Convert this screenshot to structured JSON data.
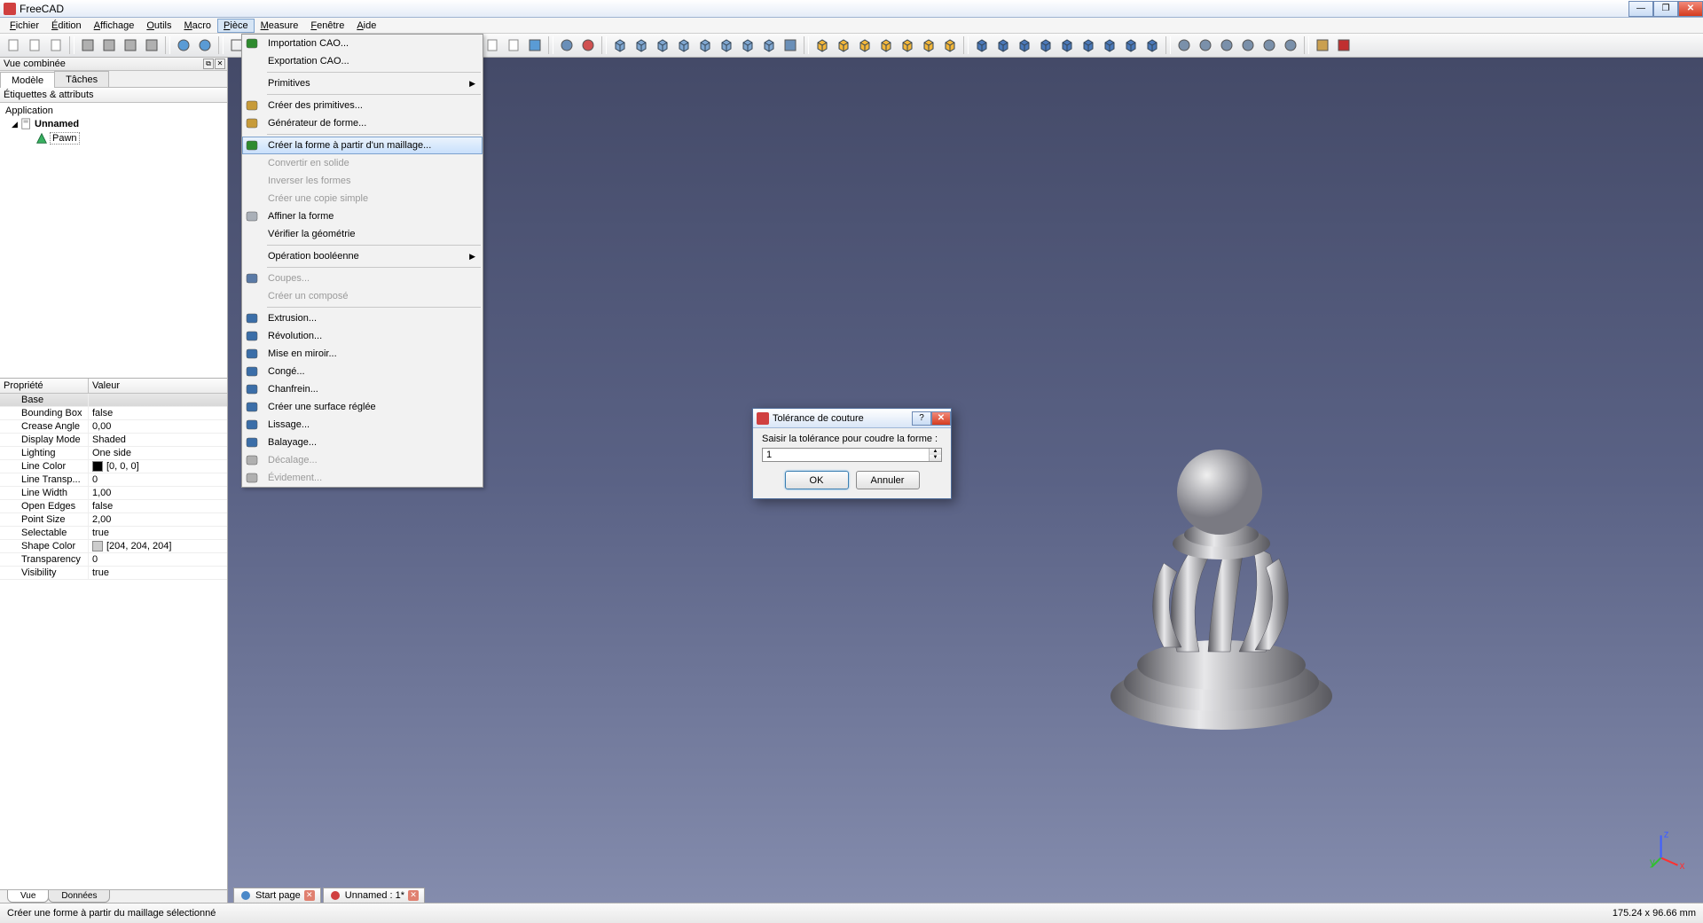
{
  "app": {
    "title": "FreeCAD"
  },
  "winbtns": {
    "min": "—",
    "max": "❐",
    "close": "✕"
  },
  "menubar": {
    "items": [
      "Fichier",
      "Édition",
      "Affichage",
      "Outils",
      "Macro",
      "Pièce",
      "Measure",
      "Fenêtre",
      "Aide"
    ],
    "active_index": 5
  },
  "sidebar": {
    "panel_title": "Vue combinée",
    "tabs": {
      "model": "Modèle",
      "tasks": "Tâches"
    },
    "tree_header": "Étiquettes & attributs",
    "tree": {
      "root": "Application",
      "doc": "Unnamed",
      "item": "Pawn"
    },
    "prop_headers": {
      "name": "Propriété",
      "value": "Valeur"
    },
    "prop_category": "Base",
    "properties": [
      {
        "name": "Bounding Box",
        "value": "false"
      },
      {
        "name": "Crease Angle",
        "value": "0,00"
      },
      {
        "name": "Display Mode",
        "value": "Shaded"
      },
      {
        "name": "Lighting",
        "value": "One side"
      },
      {
        "name": "Line Color",
        "value": "[0, 0, 0]",
        "swatch": "#000000"
      },
      {
        "name": "Line Transp...",
        "value": "0"
      },
      {
        "name": "Line Width",
        "value": "1,00"
      },
      {
        "name": "Open Edges",
        "value": "false"
      },
      {
        "name": "Point Size",
        "value": "2,00"
      },
      {
        "name": "Selectable",
        "value": "true"
      },
      {
        "name": "Shape Color",
        "value": "[204, 204, 204]",
        "swatch": "#cccccc"
      },
      {
        "name": "Transparency",
        "value": "0"
      },
      {
        "name": "Visibility",
        "value": "true"
      }
    ],
    "bottom_tabs": {
      "view": "Vue",
      "data": "Données"
    }
  },
  "dropdown": {
    "items": [
      {
        "label": "Importation CAO...",
        "icon": "#2e8b2e"
      },
      {
        "label": "Exportation CAO..."
      },
      {
        "sep": true
      },
      {
        "label": "Primitives",
        "submenu": true
      },
      {
        "sep": true
      },
      {
        "label": "Créer des primitives...",
        "icon": "#c79b3a"
      },
      {
        "label": "Générateur de forme...",
        "icon": "#c79b3a"
      },
      {
        "sep": true
      },
      {
        "label": "Créer la forme à partir d'un maillage...",
        "icon": "#2e8b2e",
        "highlight": true
      },
      {
        "label": "Convertir en solide",
        "disabled": true
      },
      {
        "label": "Inverser les formes",
        "disabled": true
      },
      {
        "label": "Créer une copie simple",
        "disabled": true
      },
      {
        "label": "Affiner la forme",
        "icon": "#aab0b8"
      },
      {
        "label": "Vérifier la géométrie"
      },
      {
        "sep": true
      },
      {
        "label": "Opération booléenne",
        "submenu": true
      },
      {
        "sep": true
      },
      {
        "label": "Coupes...",
        "icon": "#5a7aa6",
        "disabled": true
      },
      {
        "label": "Créer un composé",
        "disabled": true
      },
      {
        "sep": true
      },
      {
        "label": "Extrusion...",
        "icon": "#3b6ea8"
      },
      {
        "label": "Révolution...",
        "icon": "#3b6ea8"
      },
      {
        "label": "Mise en miroir...",
        "icon": "#3b6ea8"
      },
      {
        "label": "Congé...",
        "icon": "#3b6ea8"
      },
      {
        "label": "Chanfrein...",
        "icon": "#3b6ea8"
      },
      {
        "label": "Créer une surface réglée",
        "icon": "#3b6ea8"
      },
      {
        "label": "Lissage...",
        "icon": "#3b6ea8"
      },
      {
        "label": "Balayage...",
        "icon": "#3b6ea8"
      },
      {
        "label": "Décalage...",
        "icon": "#b0b0b0",
        "disabled": true
      },
      {
        "label": "Évidement...",
        "icon": "#b0b0b0",
        "disabled": true
      }
    ]
  },
  "viewport": {
    "tabs": [
      {
        "label": "Start page",
        "icon_color": "#4a88c8"
      },
      {
        "label": "Unnamed : 1*",
        "icon_color": "#d04040"
      }
    ]
  },
  "dialog": {
    "title": "Tolérance de couture",
    "label": "Saisir la tolérance pour coudre la forme :",
    "value": "1",
    "ok": "OK",
    "cancel": "Annuler",
    "help": "?",
    "close": "✕"
  },
  "status": {
    "text": "Créer une forme à partir du maillage sélectionné",
    "dims": "175.24 x 96.66 mm"
  },
  "toolbar_colors": [
    "#f7c469",
    "#f7c469",
    "#f7c469",
    "#b0b0b0",
    "#b0b0b0",
    "#b0b0b0",
    "#b0b0b0",
    "#b0b0b0",
    "#b0b0b0"
  ]
}
